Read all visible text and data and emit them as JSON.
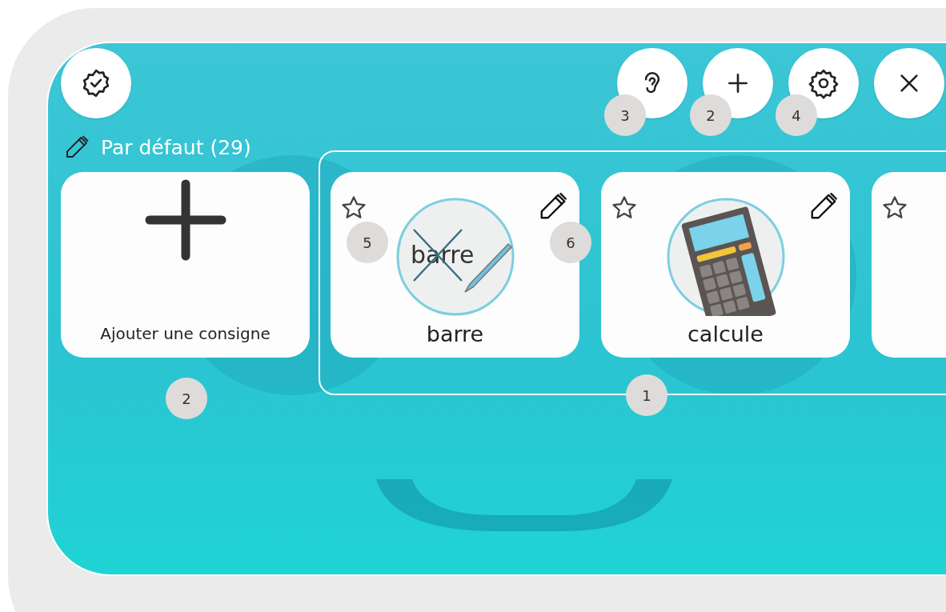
{
  "top_buttons": [
    {
      "kind": "ear",
      "badge": "3"
    },
    {
      "kind": "plus",
      "badge": "2"
    },
    {
      "kind": "gear",
      "badge": "4"
    },
    {
      "kind": "close"
    }
  ],
  "heading": "Par défaut (29)",
  "add_card": {
    "label": "Ajouter une consigne",
    "badge": "2"
  },
  "group": {
    "badge": "1"
  },
  "cards": [
    {
      "kind": "crossed-word",
      "label": "barre",
      "picture_text": "barre",
      "star_badge": "5",
      "pen_badge": "6"
    },
    {
      "kind": "calculator",
      "label": "calcule"
    },
    {
      "kind": "partial"
    }
  ]
}
